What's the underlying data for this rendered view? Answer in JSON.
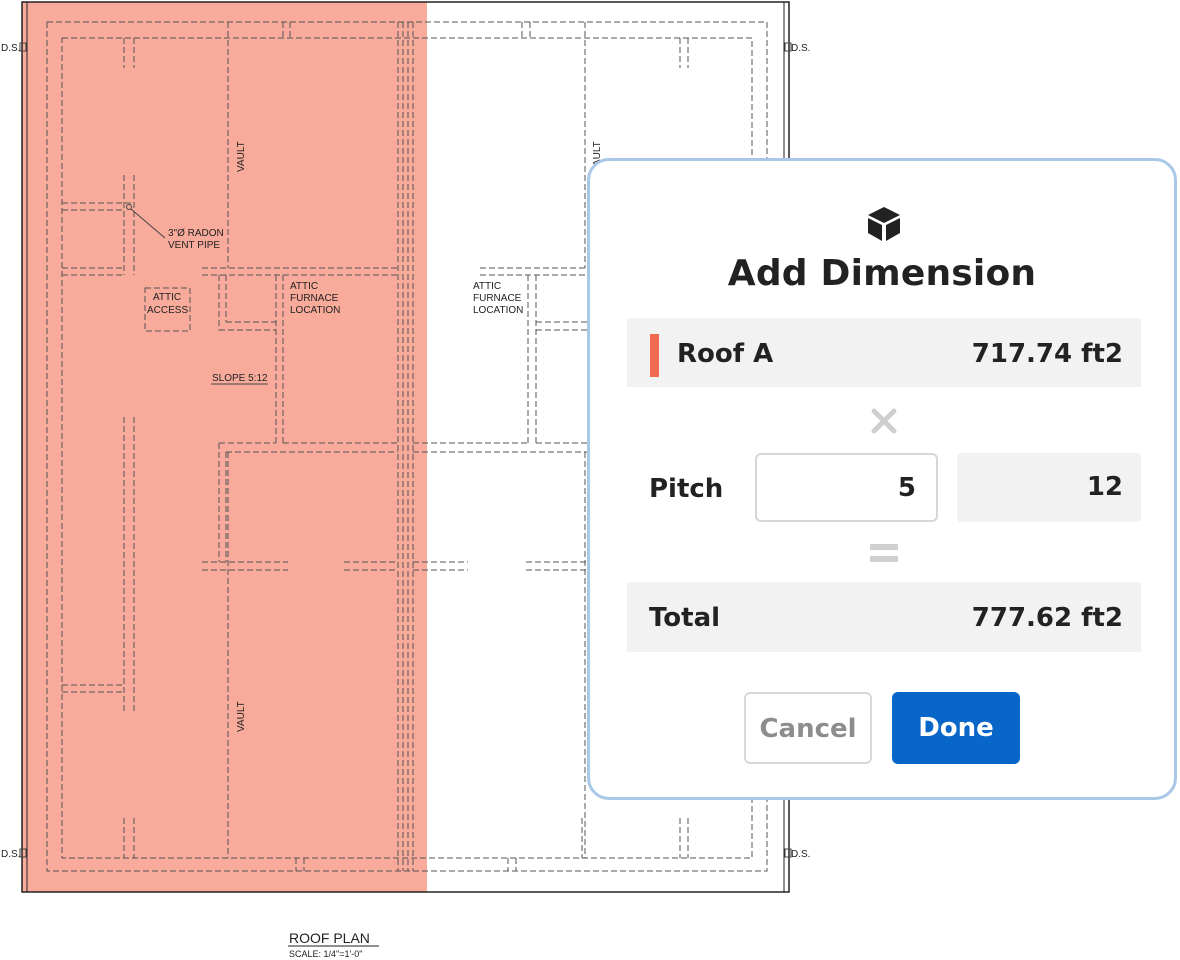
{
  "plan": {
    "labels": {
      "ds_top_left": "D.S.",
      "ds_top_right": "D.S.",
      "ds_bottom_left": "D.S.",
      "ds_bottom_right": "D.S.",
      "vault_upper_left": "VAULT",
      "vault_lower_left": "VAULT",
      "vault_upper_right": "VAULT",
      "radon_line1": "3\"Ø RADON",
      "radon_line2": "VENT PIPE",
      "attic_access_line1": "ATTIC",
      "attic_access_line2": "ACCESS",
      "attic_furnace_left_line1": "ATTIC",
      "attic_furnace_left_line2": "FURNACE",
      "attic_furnace_left_line3": "LOCATION",
      "attic_furnace_right_line1": "ATTIC",
      "attic_furnace_right_line2": "FURNACE",
      "attic_furnace_right_line3": "LOCATION",
      "slope": "SLOPE 5:12"
    },
    "title": "ROOF PLAN",
    "scale": "SCALE: 1/4\"=1'-0\"",
    "highlight_color": "#f8ab9b"
  },
  "modal": {
    "icon": "cube-icon",
    "title": "Add Dimension",
    "roof": {
      "name": "Roof A",
      "area": "717.74 ft2",
      "accent_color": "#ef6a4e"
    },
    "multiply_icon": "times-icon",
    "pitch": {
      "label": "Pitch",
      "rise": "5",
      "run": "12"
    },
    "equals_icon": "equals-icon",
    "total": {
      "label": "Total",
      "value": "777.62 ft2"
    },
    "buttons": {
      "cancel": "Cancel",
      "done": "Done"
    },
    "colors": {
      "border": "#a9c8e8",
      "primary": "#0766c7",
      "row_bg": "#f2f2f2"
    }
  }
}
